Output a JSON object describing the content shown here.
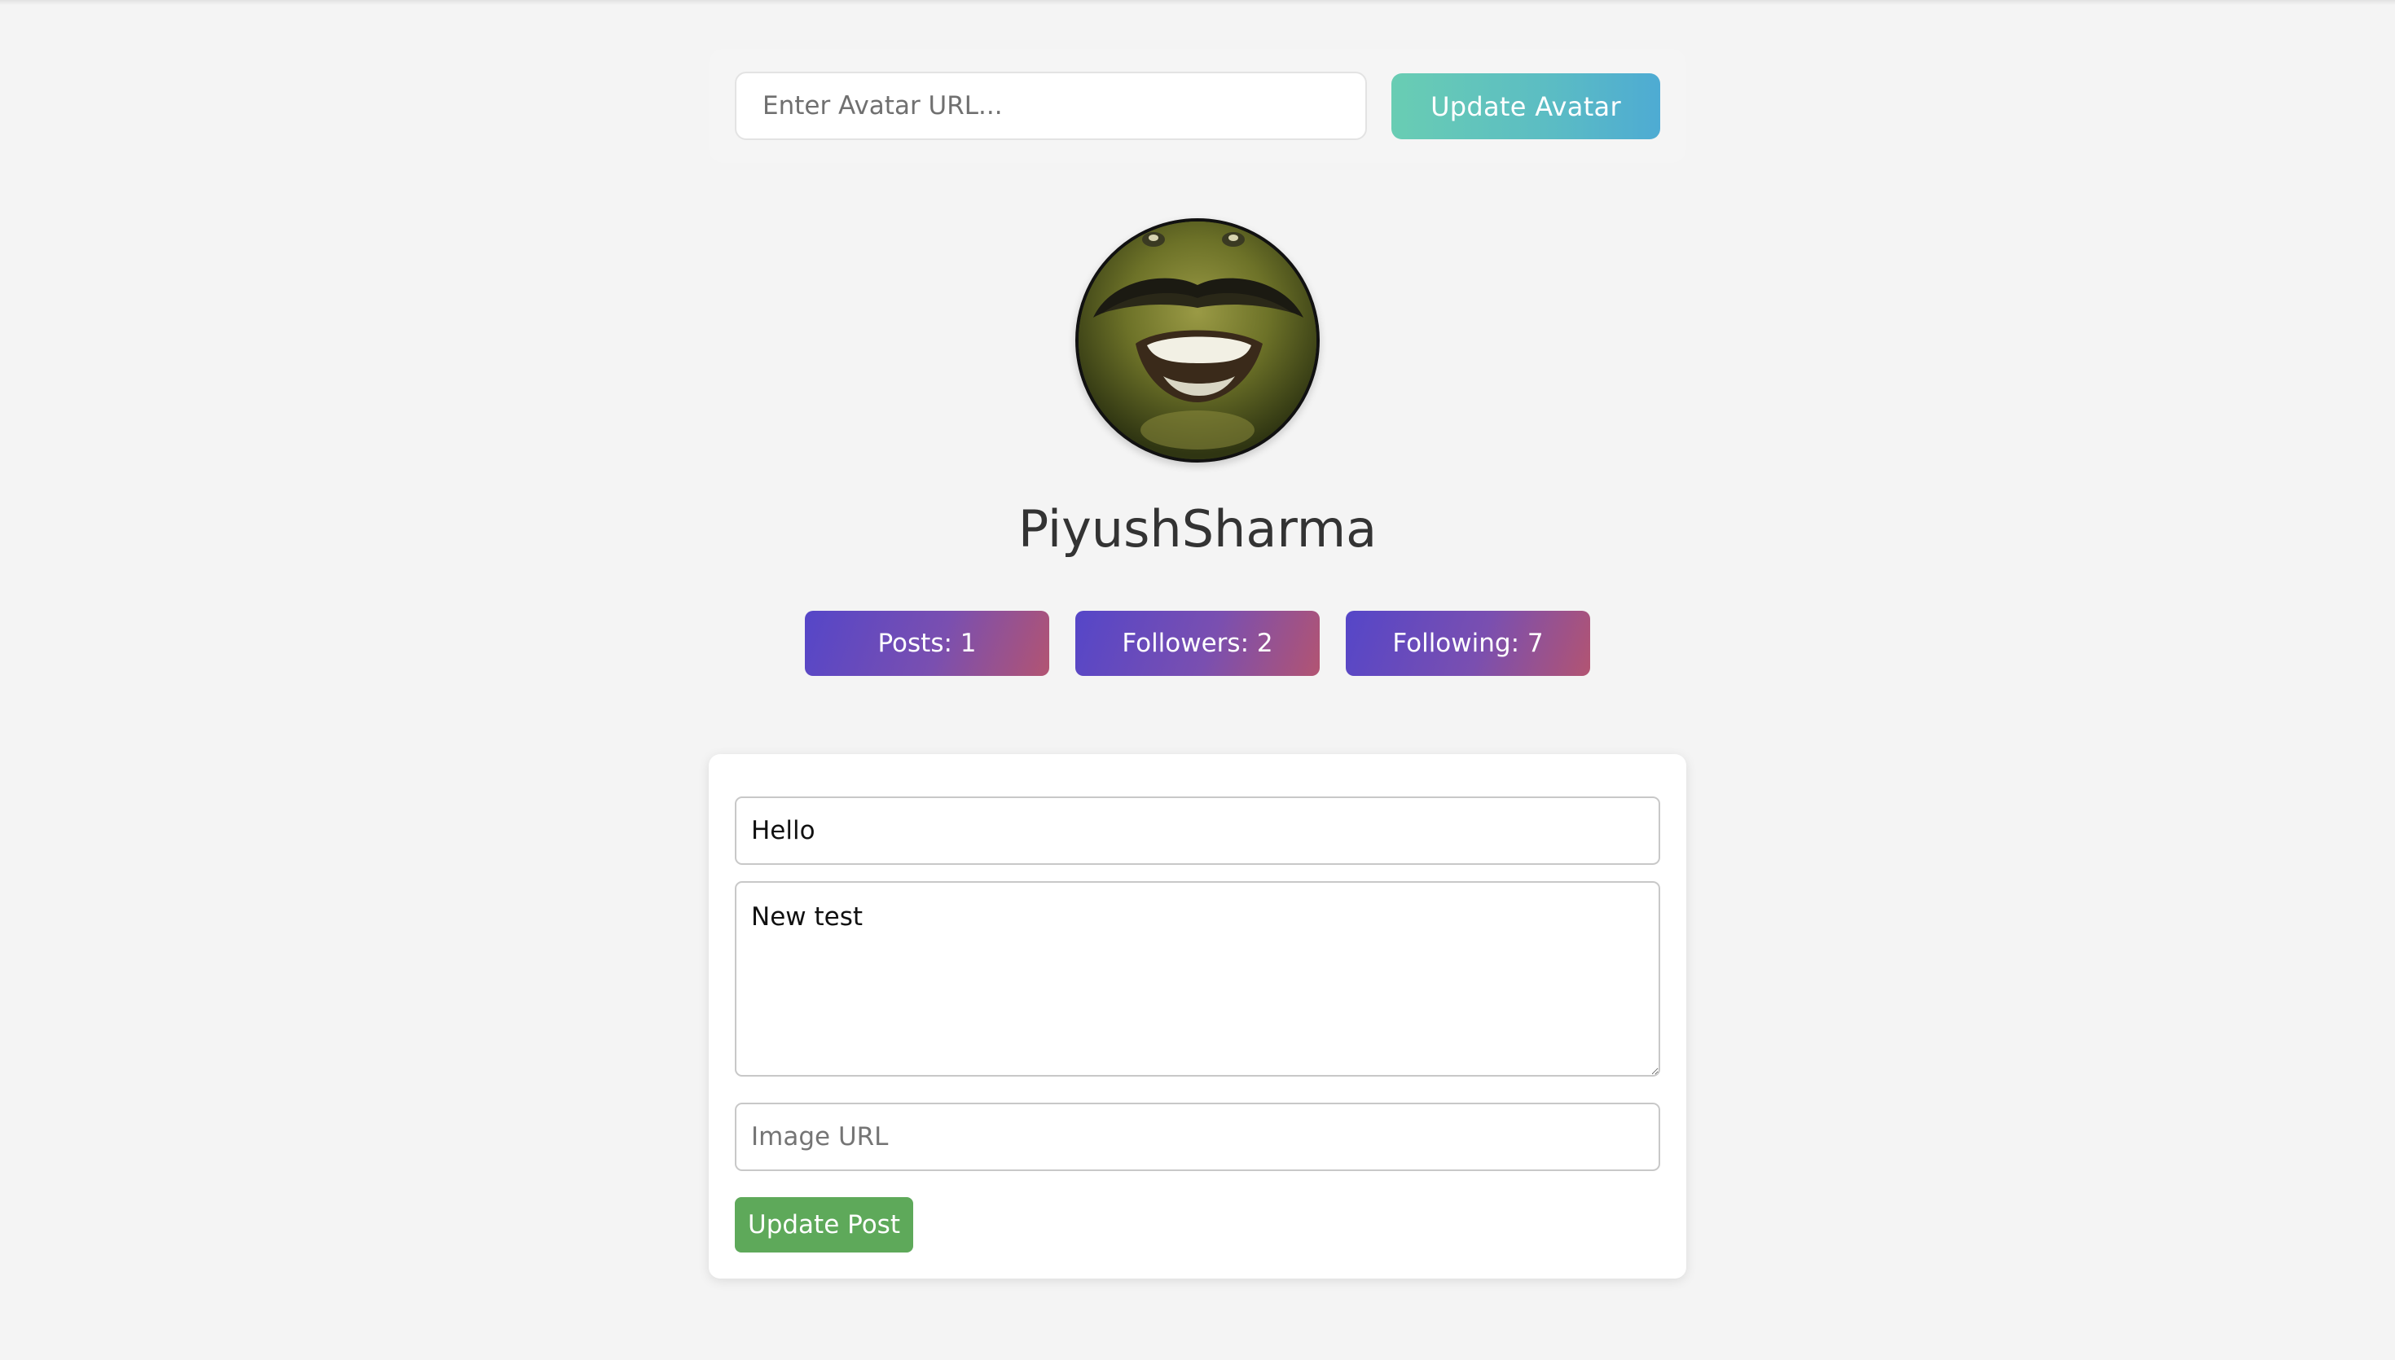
{
  "avatar_form": {
    "input_placeholder": "Enter Avatar URL...",
    "input_value": "",
    "button_label": "Update Avatar"
  },
  "profile": {
    "username": "PiyushSharma",
    "avatar_icon": "avatar-face-image"
  },
  "stats": {
    "posts": "Posts: 1",
    "followers": "Followers: 2",
    "following": "Following: 7"
  },
  "post_form": {
    "title_value": "Hello",
    "body_value": "New test",
    "image_placeholder": "Image URL",
    "image_value": "",
    "button_label": "Update Post"
  },
  "colors": {
    "background": "#f4f4f4",
    "avatar_button_gradient": [
      "#69cdb3",
      "#4eabd3"
    ],
    "stat_badge_gradient": [
      "#5546c8",
      "#b25472"
    ],
    "update_post_button": "#5ea95a",
    "username_text": "#333333"
  }
}
